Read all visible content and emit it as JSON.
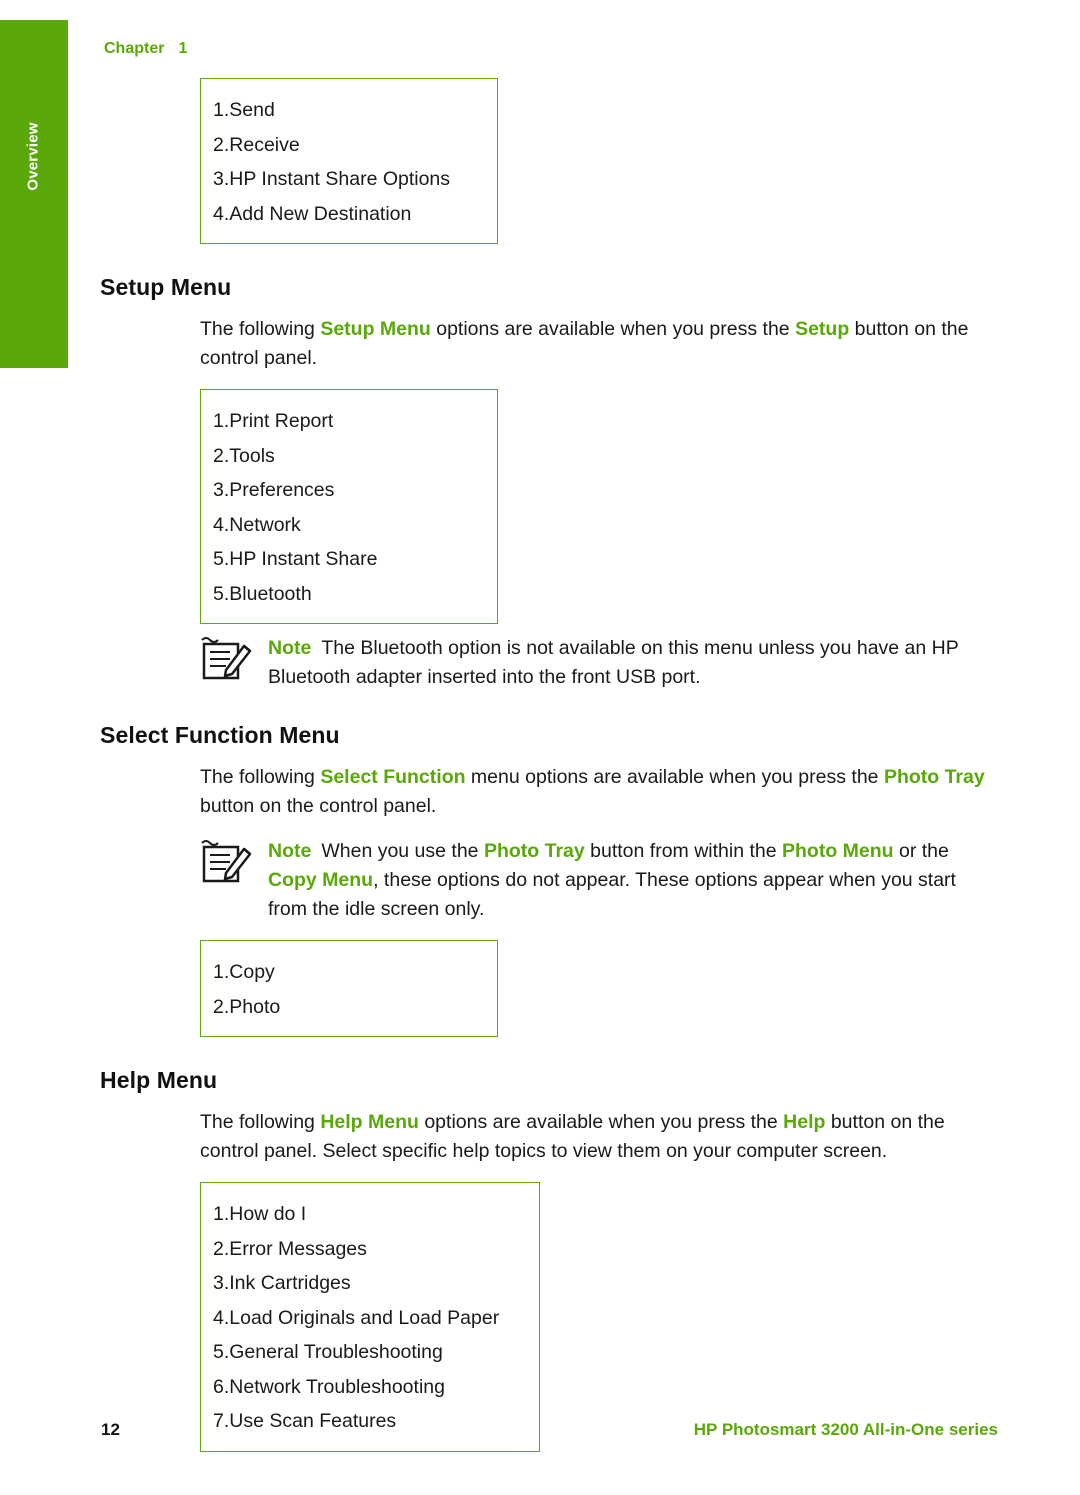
{
  "sidebar": {
    "tab_label": "Overview"
  },
  "header": {
    "chapter_word": "Chapter",
    "chapter_number": "1"
  },
  "menus": {
    "instant_share": {
      "items": [
        "1.Send",
        "2.Receive",
        "3.HP Instant Share Options",
        "4.Add New Destination"
      ]
    },
    "setup": {
      "items": [
        "1.Print Report",
        "2.Tools",
        "3.Preferences",
        "4.Network",
        "5.HP Instant Share",
        "5.Bluetooth"
      ]
    },
    "select_function": {
      "items": [
        "1.Copy",
        "2.Photo"
      ]
    },
    "help": {
      "items": [
        "1.How do I",
        "2.Error Messages",
        "3.Ink Cartridges",
        "4.Load Originals and Load Paper",
        "5.General Troubleshooting",
        "6.Network Troubleshooting",
        "7.Use Scan Features"
      ]
    }
  },
  "sections": {
    "setup_menu": {
      "heading": "Setup Menu",
      "para_1": "The following ",
      "para_1_green_a": "Setup Menu",
      "para_2": " options are available when you press the ",
      "para_2_green_b": "Setup",
      "para_3": " button on the control panel.",
      "note_label": "Note",
      "note_text": "The Bluetooth option is not available on this menu unless you have an HP Bluetooth adapter inserted into the front USB port."
    },
    "select_function_menu": {
      "heading": "Select Function Menu",
      "para_1": "The following ",
      "para_1_green_a": "Select Function",
      "para_2": " menu options are available when you press the ",
      "para_2_green_b": "Photo Tray",
      "para_3": " button on the control panel.",
      "note_label": "Note",
      "note_t1": "When you use the ",
      "note_g1": "Photo Tray",
      "note_t2": " button from within the ",
      "note_g2": "Photo Menu",
      "note_t3": " or the ",
      "note_g3": "Copy Menu",
      "note_t4": ", these options do not appear. These options appear when you start from the idle screen only."
    },
    "help_menu": {
      "heading": "Help Menu",
      "para_1": "The following ",
      "para_1_green_a": "Help Menu",
      "para_2": " options are available when you press the ",
      "para_2_green_b": "Help",
      "para_3": " button on the control panel. Select specific help topics to view them on your computer screen."
    }
  },
  "footer": {
    "page_number": "12",
    "product_title": "HP Photosmart 3200 All-in-One series"
  },
  "colors": {
    "accent_green": "#5aa80a",
    "text": "#1a1a1a"
  }
}
